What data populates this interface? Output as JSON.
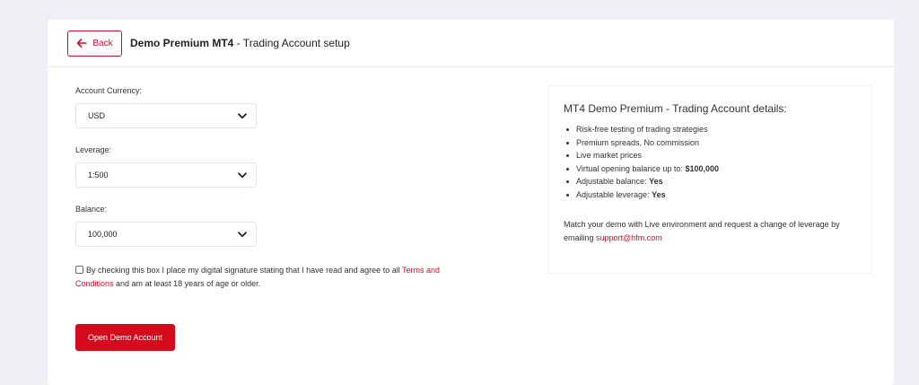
{
  "header": {
    "back_label": "Back",
    "title_bold": "Demo Premium MT4",
    "title_rest": " - Trading Account setup"
  },
  "form": {
    "currency": {
      "label": "Account Currency:",
      "value": "USD"
    },
    "leverage": {
      "label": "Leverage:",
      "value": "1:500"
    },
    "balance": {
      "label": "Balance:",
      "value": "100,000"
    },
    "agreement": {
      "text_before": "By checking this box I place my digital signature stating that I have read and agree to all ",
      "link_text": "Terms and Conditions",
      "text_after": " and am at least 18 years of age or older.",
      "checked": false
    },
    "submit_label": "Open Demo Account"
  },
  "details": {
    "title": "MT4 Demo Premium - Trading Account details:",
    "items": [
      {
        "text": "Risk-free testing of trading strategies",
        "bold": ""
      },
      {
        "text": "Premium spreads, No commission",
        "bold": ""
      },
      {
        "text": "Live market prices",
        "bold": ""
      },
      {
        "text": "Virtual opening balance up to: ",
        "bold": "$100,000"
      },
      {
        "text": "Adjustable balance: ",
        "bold": "Yes"
      },
      {
        "text": "Adjustable leverage: ",
        "bold": "Yes"
      }
    ],
    "note_text": "Match your demo with Live environment and request a change of leverage by emailing ",
    "note_email": "support@hfm.com"
  },
  "colors": {
    "accent": "#c8102e",
    "button_bg": "#d50a1d",
    "page_bg": "#eef0f6"
  },
  "icons": {
    "back": "arrow-left-icon",
    "select": "chevron-down-icon"
  }
}
